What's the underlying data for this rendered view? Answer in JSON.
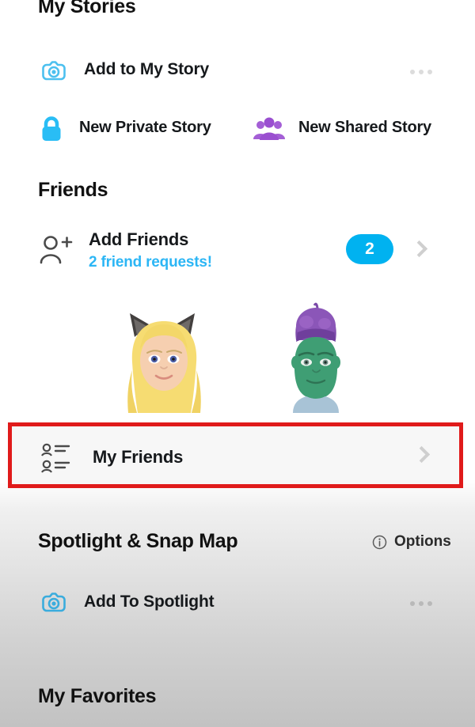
{
  "my_stories": {
    "title": "My Stories",
    "add_to_my_story": {
      "label": "Add to My Story",
      "icon": "camera-icon",
      "menu_icon": "more-options-dots-icon"
    },
    "new_private_story": {
      "label": "New Private Story",
      "icon": "lock-icon"
    },
    "new_shared_story": {
      "label": "New Shared Story",
      "icon": "group-people-icon"
    }
  },
  "friends": {
    "title": "Friends",
    "add_friends": {
      "label": "Add Friends",
      "subtitle": "2 friend requests!",
      "badge_count": "2",
      "icon": "add-person-icon",
      "chevron": "chevron-right-icon"
    },
    "avatars": [
      {
        "name": "bitmoji-blonde-cat-ears"
      },
      {
        "name": "bitmoji-green-purple-hair"
      }
    ],
    "my_friends": {
      "label": "My Friends",
      "icon": "friends-list-icon",
      "chevron": "chevron-right-icon",
      "highlighted": true
    }
  },
  "spotlight_snap_map": {
    "title": "Spotlight & Snap Map",
    "options": {
      "label": "Options",
      "icon": "info-circle-icon"
    },
    "add_to_spotlight": {
      "label": "Add To Spotlight",
      "icon": "camera-icon",
      "menu_icon": "more-options-dots-icon"
    }
  },
  "my_favorites": {
    "title": "My Favorites"
  },
  "colors": {
    "snap_blue": "#00b2f0",
    "link_blue": "#2cb6f5",
    "shared_purple": "#9b5cd6",
    "highlight_red": "#e01b1b",
    "text_dark": "#16191c"
  }
}
